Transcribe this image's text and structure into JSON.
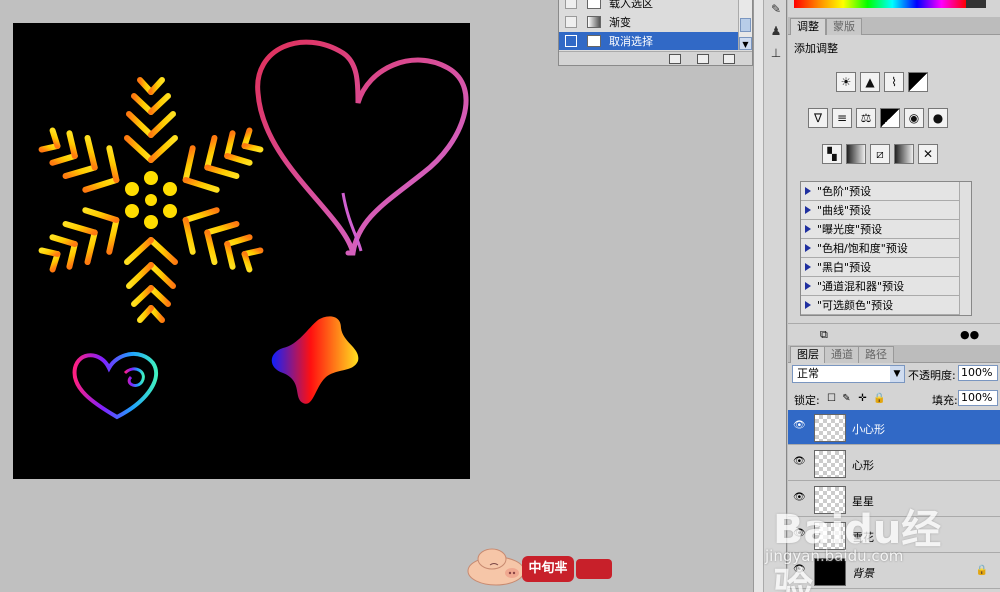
{
  "history": {
    "items": [
      {
        "label": "载入选区",
        "selected": false
      },
      {
        "label": "渐变",
        "selected": false
      },
      {
        "label": "取消选择",
        "selected": true
      }
    ]
  },
  "adjustments_panel": {
    "tabs": [
      {
        "label": "调整",
        "active": true
      },
      {
        "label": "蒙版",
        "active": false
      }
    ],
    "title": "添加调整",
    "presets": [
      "\"色阶\"预设",
      "\"曲线\"预设",
      "\"曝光度\"预设",
      "\"色相/饱和度\"预设",
      "\"黑白\"预设",
      "\"通道混和器\"预设",
      "\"可选颜色\"预设"
    ]
  },
  "layers_panel": {
    "tabs": [
      {
        "label": "图层",
        "active": true
      },
      {
        "label": "通道",
        "active": false
      },
      {
        "label": "路径",
        "active": false
      }
    ],
    "blend_mode": "正常",
    "opacity_label": "不透明度:",
    "opacity_value": "100%",
    "lock_label": "锁定:",
    "fill_label": "填充:",
    "fill_value": "100%",
    "layers": [
      {
        "name": "小心形",
        "selected": true,
        "thumb": "transparent"
      },
      {
        "name": "心形",
        "selected": false,
        "thumb": "transparent"
      },
      {
        "name": "星星",
        "selected": false,
        "thumb": "transparent"
      },
      {
        "name": "雪花",
        "selected": false,
        "thumb": "transparent"
      },
      {
        "name": "背景",
        "selected": false,
        "thumb": "black",
        "locked": true
      }
    ]
  },
  "canvas": {
    "background": "#000000",
    "shapes": [
      "snowflake",
      "large-heart",
      "small-heart",
      "star"
    ]
  },
  "watermark": {
    "logo": "Baidu经验",
    "url": "jingyan.baidu.com"
  },
  "stamp": {
    "text": "中旬芈"
  },
  "colors": {
    "selection": "#3169c6",
    "panel": "#d4d4d4"
  }
}
